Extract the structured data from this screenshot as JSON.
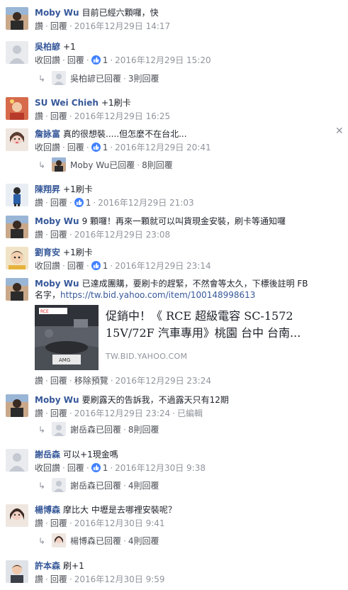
{
  "labels": {
    "like": "讚",
    "unlike": "收回讚",
    "reply": "回覆",
    "remove_preview": "移除預覽",
    "edited": "已編輯",
    "sep": "·"
  },
  "comments": [
    {
      "author": "Moby Wu",
      "text": "目前已經六顆囉，快",
      "like_label": "讚",
      "likes": "",
      "time": "2016年12月29日 14:17"
    },
    {
      "author": "吳柏諺",
      "text": "+1",
      "like_label": "收回讚",
      "likes": "1",
      "time": "2016年12月29日 15:20",
      "reply_summary": {
        "text": "吳柏諺已回覆",
        "count": "3則回覆"
      }
    },
    {
      "author": "SU Wei Chieh",
      "text": "+1刷卡",
      "like_label": "讚",
      "likes": "",
      "time": "2016年12月29日 16:25"
    },
    {
      "author": "詹詠富",
      "text": "真的很想裝.....但怎麼不在台北...",
      "like_label": "收回讚",
      "likes": "1",
      "time": "2016年12月29日 20:41",
      "reply_summary": {
        "text": "Moby Wu已回覆",
        "count": "8則回覆"
      }
    },
    {
      "author": "陳翔昇",
      "text": "+1刷卡",
      "like_label": "讚",
      "likes": "1",
      "time": "2016年12月29日 21:03"
    },
    {
      "author": "Moby Wu",
      "text": "9 顆囉！再來一顆就可以叫貨現金安裝，刷卡等通知囉",
      "like_label": "讚",
      "likes": "",
      "time": "2016年12月29日 23:08"
    },
    {
      "author": "劉育安",
      "text": "+1刷卡",
      "like_label": "收回讚",
      "likes": "1",
      "time": "2016年12月29日 23:14"
    },
    {
      "author": "Moby Wu",
      "text": "已達成團購，要刷卡的趕緊，不然會等太久，下標後註明 FB",
      "text2": "名字，",
      "link": "https://tw.bid.yahoo.com/item/100148998613",
      "like_label": "讚",
      "likes": "",
      "time": "2016年12月29日 23:24",
      "preview": {
        "title": "促銷中！《 RCE 超級電容 SC-1572 15V/72F 汽車專用》桃園 台中 台南...",
        "domain": "TW.BID.YAHOO.COM",
        "image_plate": "AMG",
        "image_logo": "RCE"
      }
    },
    {
      "author": "Moby Wu",
      "text": "要刷露天的告訴我，不過露天只有12期",
      "like_label": "讚",
      "likes": "",
      "time": "2016年12月29日 23:24",
      "reply_summary": {
        "text": "謝岳森已回覆",
        "count": "8則回覆"
      }
    },
    {
      "author": "謝岳森",
      "text": "可以+1現金嗎",
      "like_label": "收回讚",
      "likes": "1",
      "time": "2016年12月30日 9:38",
      "reply_summary": {
        "text": "謝岳森已回覆",
        "count": "4則回覆"
      }
    },
    {
      "author": "楊博森",
      "text": "摩比大 中壢是去哪裡安裝呢？",
      "like_label": "讚",
      "likes": "",
      "time": "2016年12月30日 9:41",
      "reply_summary": {
        "text": "楊博森已回覆",
        "count": "4則回覆"
      }
    },
    {
      "author": "許本森",
      "text": "刷+1",
      "like_label": "讚",
      "likes": "",
      "time": "2016年12月30日 9:59"
    }
  ],
  "colors": {
    "link": "#365899",
    "meta": "#90949c",
    "action": "#4b4f56",
    "like_badge": "#4080ff"
  }
}
